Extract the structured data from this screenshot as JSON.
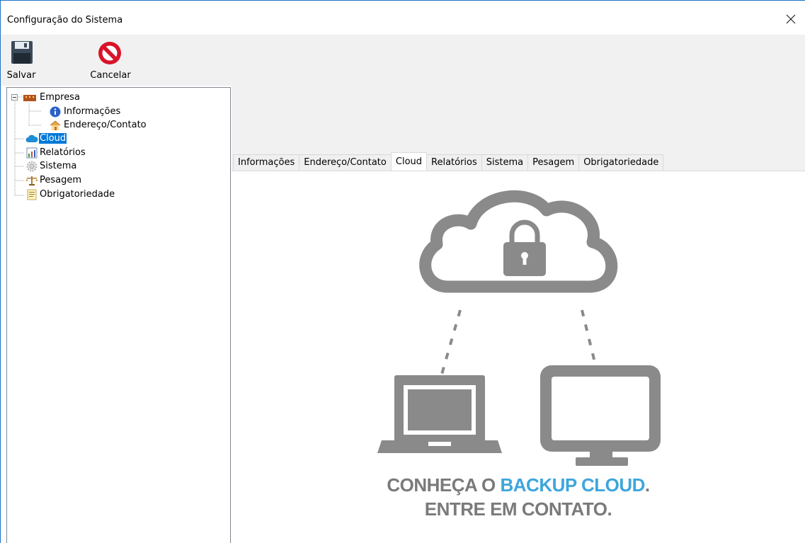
{
  "window": {
    "title": "Configuração do Sistema"
  },
  "toolbar": {
    "save_label": "Salvar",
    "cancel_label": "Cancelar"
  },
  "tree": {
    "items": [
      {
        "label": "Empresa",
        "icon": "company-icon"
      },
      {
        "label": "Informações",
        "icon": "info-icon"
      },
      {
        "label": "Endereço/Contato",
        "icon": "house-icon"
      },
      {
        "label": "Cloud",
        "icon": "cloud-icon",
        "selected": true
      },
      {
        "label": "Relatórios",
        "icon": "report-icon"
      },
      {
        "label": "Sistema",
        "icon": "gear-icon"
      },
      {
        "label": "Pesagem",
        "icon": "scale-icon"
      },
      {
        "label": "Obrigatoriedade",
        "icon": "checklist-icon"
      }
    ]
  },
  "tabs": [
    {
      "label": "Informações"
    },
    {
      "label": "Endereço/Contato"
    },
    {
      "label": "Cloud",
      "active": true
    },
    {
      "label": "Relatórios"
    },
    {
      "label": "Sistema"
    },
    {
      "label": "Pesagem"
    },
    {
      "label": "Obrigatoriedade"
    }
  ],
  "banner": {
    "line1_prefix": "CONHEÇA O ",
    "line1_accent": "BACKUP CLOUD",
    "line1_suffix": ".",
    "line2": "ENTRE EM CONTATO."
  },
  "colors": {
    "selection": "#0078d7",
    "accent": "#3ea6dc",
    "illustration_gray": "#8a8a8a"
  }
}
